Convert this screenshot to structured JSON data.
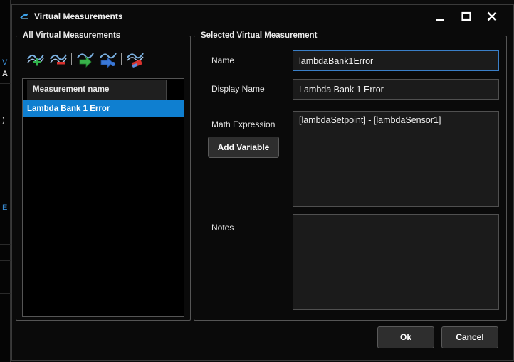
{
  "window": {
    "title": "Virtual Measurements",
    "minimize_symbol": "minimize-icon",
    "maximize_symbol": "maximize-icon",
    "close_symbol": "close-icon"
  },
  "left_panel": {
    "title": "All Virtual Measurements",
    "toolbar": [
      {
        "name": "add-measurement-icon"
      },
      {
        "name": "remove-measurement-icon"
      },
      {
        "name": "import-measurement-icon"
      },
      {
        "name": "export-measurement-icon"
      },
      {
        "name": "clear-measurement-icon"
      }
    ],
    "list": {
      "column_header": "Measurement name",
      "rows": [
        "Lambda Bank 1 Error"
      ],
      "selected_index": 0
    }
  },
  "right_panel": {
    "title": "Selected Virtual Measurement",
    "name_label": "Name",
    "name_value": "lambdaBank1Error",
    "display_name_label": "Display Name",
    "display_name_value": "Lambda Bank 1 Error",
    "math_expression_label": "Math Expression",
    "math_expression_value": "[lambdaSetpoint] - [lambdaSensor1]",
    "add_variable_label": "Add Variable",
    "notes_label": "Notes",
    "notes_value": ""
  },
  "footer": {
    "ok_label": "Ok",
    "cancel_label": "Cancel"
  },
  "background": {
    "fragments": [
      "V",
      "A",
      ")",
      "E"
    ]
  },
  "colors": {
    "selection": "#0f7fd0",
    "focus_border": "#3a7fc8",
    "dialog_bg": "#0a0a0a"
  }
}
